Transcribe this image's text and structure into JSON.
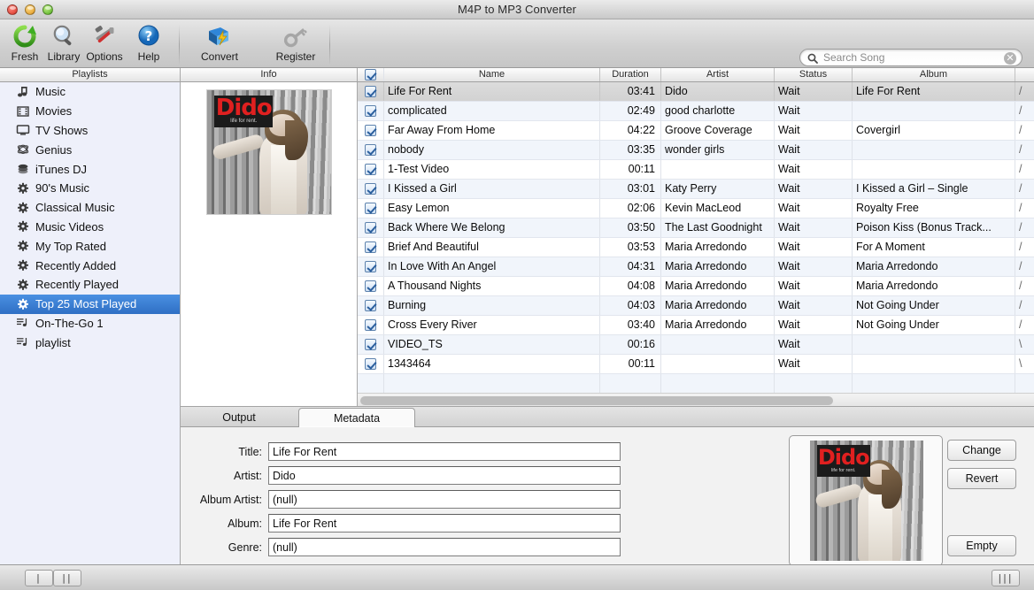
{
  "window": {
    "title": "M4P to MP3 Converter",
    "traffic_lights": [
      "close",
      "minimize",
      "zoom"
    ]
  },
  "toolbar": {
    "items": [
      {
        "id": "fresh",
        "label": "Fresh",
        "icon": "refresh-icon"
      },
      {
        "id": "library",
        "label": "Library",
        "icon": "magnifier-icon"
      },
      {
        "id": "options",
        "label": "Options",
        "icon": "hammer-wrench-icon"
      },
      {
        "id": "help",
        "label": "Help",
        "icon": "question-help-icon"
      },
      {
        "id": "convert",
        "label": "Convert",
        "icon": "book-lightning-icon"
      },
      {
        "id": "register",
        "label": "Register",
        "icon": "key-icon"
      }
    ]
  },
  "search": {
    "placeholder": "Search Song",
    "value": "",
    "caption": "Search Song",
    "icon": "search-icon",
    "clear_icon": "clear-circle-icon"
  },
  "sidebar": {
    "header": "Playlists",
    "items": [
      {
        "label": "Music",
        "icon": "music-note-icon",
        "selected": false
      },
      {
        "label": "Movies",
        "icon": "film-icon",
        "selected": false
      },
      {
        "label": "TV Shows",
        "icon": "tv-icon",
        "selected": false
      },
      {
        "label": "Genius",
        "icon": "genius-icon",
        "selected": false
      },
      {
        "label": "iTunes DJ",
        "icon": "itunes-dj-icon",
        "selected": false
      },
      {
        "label": "90's Music",
        "icon": "gear-icon",
        "selected": false
      },
      {
        "label": "Classical Music",
        "icon": "gear-icon",
        "selected": false
      },
      {
        "label": "Music Videos",
        "icon": "gear-icon",
        "selected": false
      },
      {
        "label": "My Top Rated",
        "icon": "gear-icon",
        "selected": false
      },
      {
        "label": "Recently Added",
        "icon": "gear-icon",
        "selected": false
      },
      {
        "label": "Recently Played",
        "icon": "gear-icon",
        "selected": false
      },
      {
        "label": "Top 25 Most Played",
        "icon": "gear-icon",
        "selected": true
      },
      {
        "label": "On-The-Go 1",
        "icon": "playlist-icon",
        "selected": false
      },
      {
        "label": "playlist",
        "icon": "playlist-icon",
        "selected": false
      }
    ],
    "selected_color": "#2f6fc4"
  },
  "info_panel": {
    "header": "Info",
    "artwork_alt": "Dido - Life For Rent album cover",
    "artwork_title": "Dido",
    "artwork_subtitle": "life for rent."
  },
  "table": {
    "columns": [
      "",
      "Name",
      "Duration",
      "Artist",
      "Status",
      "Album",
      ""
    ],
    "header_checkbox_checked": true,
    "rows": [
      {
        "checked": true,
        "name": "Life For Rent",
        "duration": "03:41",
        "artist": "Dido",
        "status": "Wait",
        "album": "Life For Rent",
        "path": "/",
        "selected": true
      },
      {
        "checked": true,
        "name": "complicated",
        "duration": "02:49",
        "artist": "good charlotte",
        "status": "Wait",
        "album": "",
        "path": "/",
        "selected": false
      },
      {
        "checked": true,
        "name": "Far Away From Home",
        "duration": "04:22",
        "artist": "Groove Coverage",
        "status": "Wait",
        "album": "Covergirl",
        "path": "/",
        "selected": false
      },
      {
        "checked": true,
        "name": "nobody",
        "duration": "03:35",
        "artist": "wonder girls",
        "status": "Wait",
        "album": "",
        "path": "/",
        "selected": false
      },
      {
        "checked": true,
        "name": "1-Test Video",
        "duration": "00:11",
        "artist": "",
        "status": "Wait",
        "album": "",
        "path": "/",
        "selected": false
      },
      {
        "checked": true,
        "name": "I Kissed a Girl",
        "duration": "03:01",
        "artist": "Katy Perry",
        "status": "Wait",
        "album": "I Kissed a Girl – Single",
        "path": "/",
        "selected": false
      },
      {
        "checked": true,
        "name": "Easy Lemon",
        "duration": "02:06",
        "artist": "Kevin MacLeod",
        "status": "Wait",
        "album": "Royalty Free",
        "path": "/",
        "selected": false
      },
      {
        "checked": true,
        "name": "Back Where We Belong",
        "duration": "03:50",
        "artist": "The Last Goodnight",
        "status": "Wait",
        "album": "Poison Kiss (Bonus Track...",
        "path": "/",
        "selected": false
      },
      {
        "checked": true,
        "name": "Brief And Beautiful",
        "duration": "03:53",
        "artist": "Maria Arredondo",
        "status": "Wait",
        "album": "For A Moment",
        "path": "/",
        "selected": false
      },
      {
        "checked": true,
        "name": "In Love With An Angel",
        "duration": "04:31",
        "artist": "Maria Arredondo",
        "status": "Wait",
        "album": "Maria Arredondo",
        "path": "/",
        "selected": false
      },
      {
        "checked": true,
        "name": "A Thousand Nights",
        "duration": "04:08",
        "artist": "Maria Arredondo",
        "status": "Wait",
        "album": "Maria Arredondo",
        "path": "/",
        "selected": false
      },
      {
        "checked": true,
        "name": "Burning",
        "duration": "04:03",
        "artist": "Maria Arredondo",
        "status": "Wait",
        "album": "Not Going Under",
        "path": "/",
        "selected": false
      },
      {
        "checked": true,
        "name": "Cross Every River",
        "duration": "03:40",
        "artist": "Maria Arredondo",
        "status": "Wait",
        "album": "Not Going Under",
        "path": "/",
        "selected": false
      },
      {
        "checked": true,
        "name": "VIDEO_TS",
        "duration": "00:16",
        "artist": "",
        "status": "Wait",
        "album": "",
        "path": "\\",
        "selected": false
      },
      {
        "checked": true,
        "name": "1343464",
        "duration": "00:11",
        "artist": "",
        "status": "Wait",
        "album": "",
        "path": "\\",
        "selected": false
      }
    ]
  },
  "bottom_panel": {
    "tabs": [
      {
        "id": "output",
        "label": "Output",
        "active": false
      },
      {
        "id": "metadata",
        "label": "Metadata",
        "active": true
      }
    ],
    "metadata_fields": [
      {
        "id": "title",
        "label": "Title:",
        "value": "Life For Rent"
      },
      {
        "id": "artist",
        "label": "Artist:",
        "value": "Dido"
      },
      {
        "id": "album_artist",
        "label": "Album Artist:",
        "value": "(null)"
      },
      {
        "id": "album",
        "label": "Album:",
        "value": "Life For Rent"
      },
      {
        "id": "genre",
        "label": "Genre:",
        "value": "(null)"
      }
    ],
    "artwork_buttons": [
      {
        "id": "change",
        "label": "Change"
      },
      {
        "id": "revert",
        "label": "Revert"
      },
      {
        "id": "empty",
        "label": "Empty"
      }
    ]
  },
  "status_bar": {
    "play_glyph": "|",
    "pause_glyph": "||",
    "right_glyph": "|||"
  }
}
